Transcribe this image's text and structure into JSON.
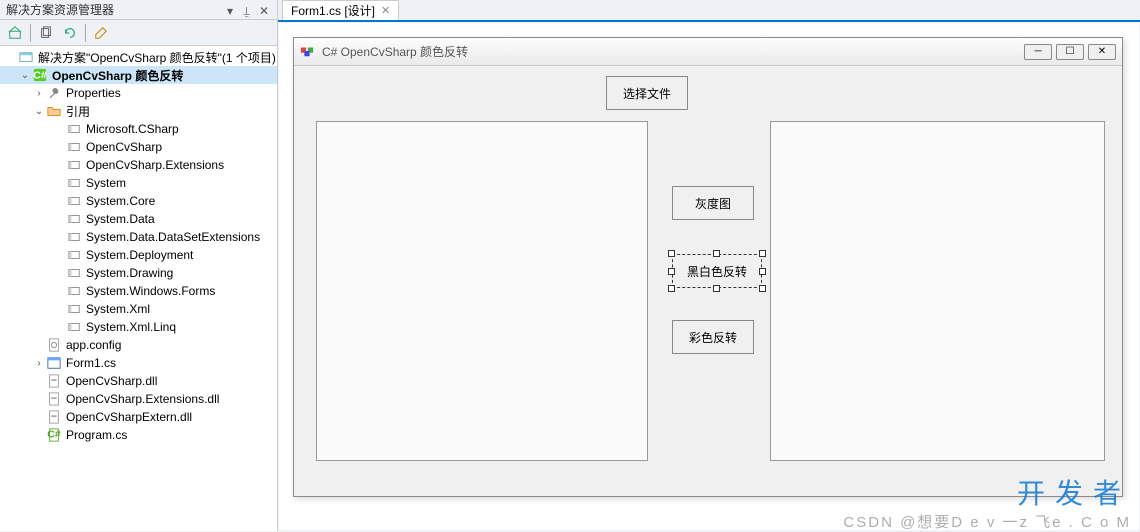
{
  "explorer": {
    "title": "解决方案资源管理器",
    "solution_label": "解决方案\"OpenCvSharp 颜色反转\"(1 个项目)",
    "project_label": "OpenCvSharp 颜色反转",
    "properties_label": "Properties",
    "references_label": "引用",
    "refs": [
      "Microsoft.CSharp",
      "OpenCvSharp",
      "OpenCvSharp.Extensions",
      "System",
      "System.Core",
      "System.Data",
      "System.Data.DataSetExtensions",
      "System.Deployment",
      "System.Drawing",
      "System.Windows.Forms",
      "System.Xml",
      "System.Xml.Linq"
    ],
    "files": {
      "app_config": "app.config",
      "form1": "Form1.cs",
      "ocs_dll": "OpenCvSharp.dll",
      "ocs_ext_dll": "OpenCvSharp.Extensions.dll",
      "ocs_extern_dll": "OpenCvSharpExtern.dll",
      "program": "Program.cs"
    }
  },
  "tabs": {
    "form1": "Form1.cs [设计]"
  },
  "form": {
    "title": "C# OpenCvSharp 颜色反转",
    "btn_select": "选择文件",
    "btn_gray": "灰度图",
    "btn_bw": "黑白色反转",
    "btn_color": "彩色反转"
  },
  "watermark": {
    "cn": "开发者",
    "en": "CSDN @想要D e v 一z 飞e . C o M"
  }
}
